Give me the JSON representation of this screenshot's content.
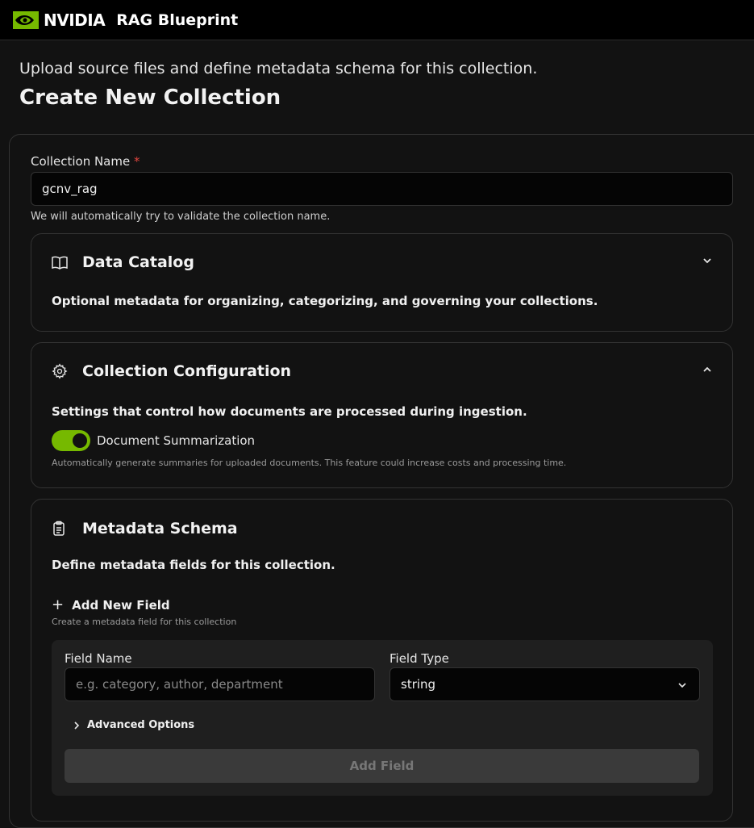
{
  "app": {
    "brand": "NVIDIA",
    "title": "RAG Blueprint"
  },
  "header": {
    "subtitle": "Upload source files and define metadata schema for this collection.",
    "title": "Create New Collection"
  },
  "collection_name": {
    "label": "Collection Name",
    "required_mark": "*",
    "value": "gcnv_rag",
    "helper": "We will automatically try to validate the collection name."
  },
  "data_catalog": {
    "title": "Data Catalog",
    "description": "Optional metadata for organizing, categorizing, and governing your collections.",
    "icon": "book-icon",
    "expanded": false
  },
  "collection_config": {
    "title": "Collection Configuration",
    "description": "Settings that control how documents are processed during ingestion.",
    "icon": "gear-icon",
    "expanded": true,
    "toggle_label": "Document Summarization",
    "toggle_on": true,
    "toggle_helper": "Automatically generate summaries for uploaded documents. This feature could increase costs and processing time."
  },
  "metadata_schema": {
    "title": "Metadata Schema",
    "description": "Define metadata fields for this collection.",
    "icon": "clipboard-icon",
    "add_new_field": "Add New Field",
    "add_new_field_helper": "Create a metadata field for this collection",
    "field_name_label": "Field Name",
    "field_name_placeholder": "e.g. category, author, department",
    "field_type_label": "Field Type",
    "field_type_value": "string",
    "advanced_options": "Advanced Options",
    "add_field_button": "Add Field"
  },
  "colors": {
    "accent": "#76b900",
    "required": "#e0463f",
    "background": "#121212"
  }
}
